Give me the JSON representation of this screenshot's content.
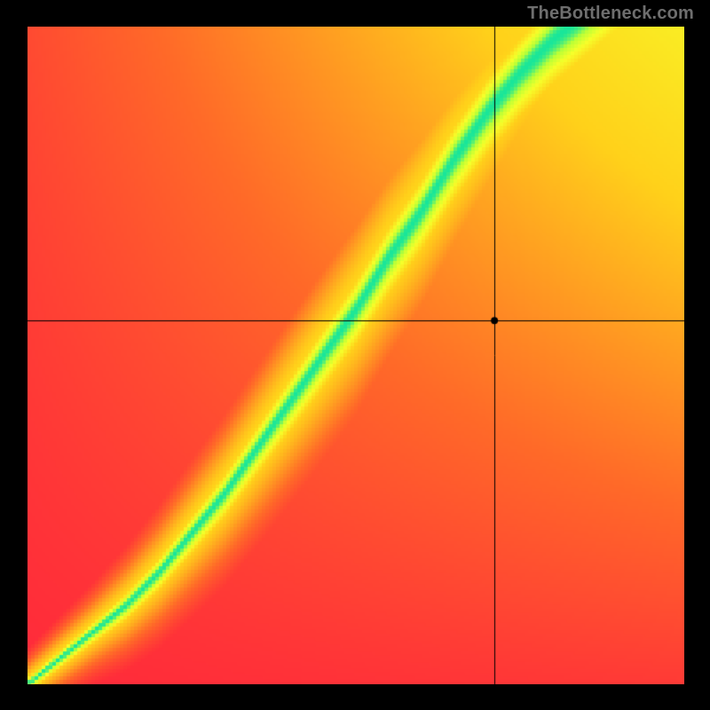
{
  "watermark": "TheBottleneck.com",
  "chart_data": {
    "type": "heatmap",
    "title": "",
    "xlabel": "",
    "ylabel": "",
    "xlim": [
      0,
      1
    ],
    "ylim": [
      0,
      1
    ],
    "axis_ticks_visible": false,
    "color_scale": {
      "0.00": "#ff1a3f",
      "0.25": "#ff6a28",
      "0.50": "#ffd11a",
      "0.75": "#f6ff2a",
      "0.90": "#baff36",
      "1.00": "#18e69a"
    },
    "ridge_curve": {
      "description": "y location of maximum (green) as function of x, normalized 0..1 with y=0 at bottom",
      "x": [
        0.0,
        0.05,
        0.1,
        0.15,
        0.2,
        0.25,
        0.3,
        0.35,
        0.4,
        0.45,
        0.5,
        0.55,
        0.6,
        0.65,
        0.7,
        0.75,
        0.8,
        0.85,
        0.9,
        0.95,
        1.0
      ],
      "y": [
        0.0,
        0.04,
        0.08,
        0.12,
        0.17,
        0.23,
        0.29,
        0.36,
        0.43,
        0.5,
        0.57,
        0.65,
        0.72,
        0.8,
        0.87,
        0.93,
        0.98,
        1.02,
        1.06,
        1.09,
        1.12
      ]
    },
    "ridge_sigma": {
      "description": "half-width (1/e) of green band in y, normalized units, as function of x",
      "x": [
        0.0,
        0.1,
        0.2,
        0.3,
        0.4,
        0.5,
        0.6,
        0.7,
        0.8,
        0.9,
        1.0
      ],
      "sigma": [
        0.008,
        0.012,
        0.018,
        0.024,
        0.03,
        0.036,
        0.04,
        0.043,
        0.046,
        0.048,
        0.05
      ]
    },
    "background_field": {
      "description": "slow background drift from red (low-left / bottom-right) to yellow (upper-right); amplitude relative to peak",
      "corner_values": {
        "bottom_left": 0.05,
        "bottom_right": 0.1,
        "top_left": 0.15,
        "top_right": 0.65
      }
    },
    "crosshair": {
      "x": 0.711,
      "y": 0.553
    },
    "marker_point": {
      "x": 0.711,
      "y": 0.553,
      "radius_px": 4,
      "color": "#000000"
    },
    "pixelation_block_size": 4
  }
}
